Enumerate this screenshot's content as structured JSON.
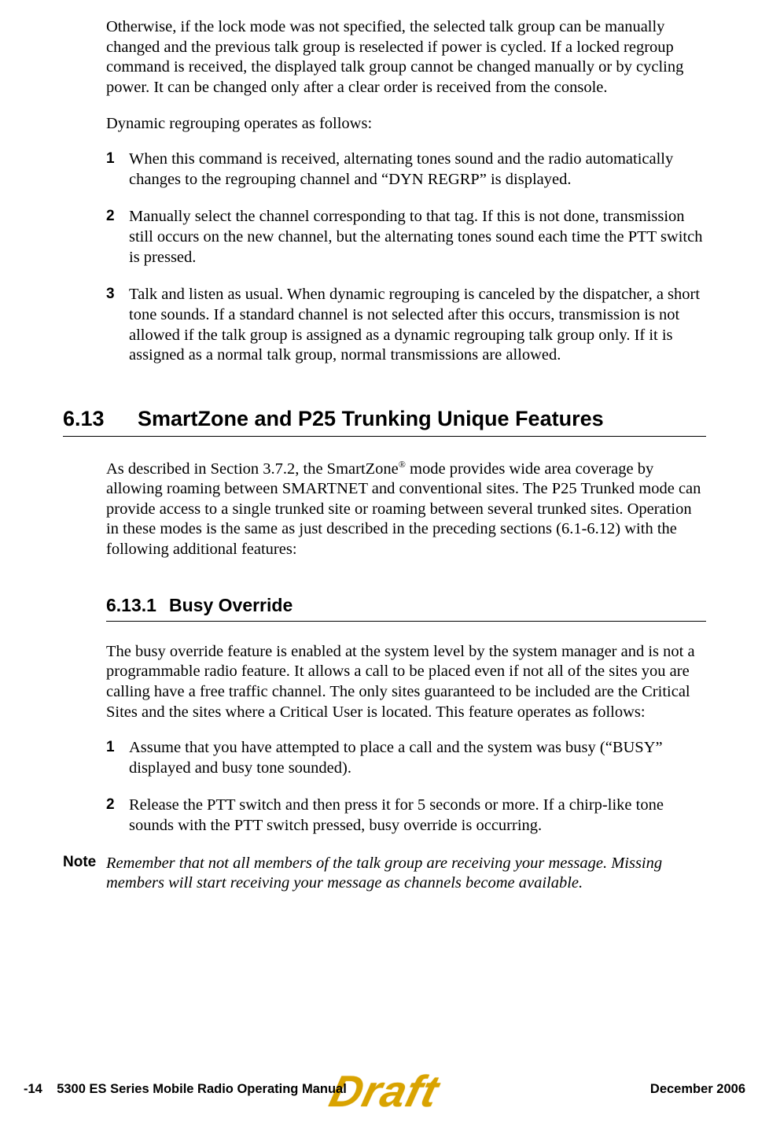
{
  "intro": {
    "para1": "Otherwise, if the lock mode was not specified, the selected talk group can be manually changed and the previous talk group is reselected if power is cycled. If a locked regroup command is received, the displayed talk group cannot be changed manually or by cycling power. It can be changed only after a clear order is received from the console.",
    "para2": "Dynamic regrouping operates as follows:"
  },
  "list1": {
    "items": [
      {
        "n": "1",
        "text": "When this command is received, alternating tones sound and the radio automatically changes to the regrouping channel and “DYN REGRP” is displayed."
      },
      {
        "n": "2",
        "text": "Manually select the channel corresponding to that tag. If this is not done, transmission still occurs on the new channel, but the alternating tones sound each time the PTT switch is pressed."
      },
      {
        "n": "3",
        "text": "Talk and listen as usual. When dynamic regrouping is canceled by the dispatcher, a short tone sounds. If a standard channel is not selected after this occurs, transmission is not allowed if the talk group is assigned as a dynamic regrouping talk group only. If it is assigned as a normal talk group, normal transmissions are allowed."
      }
    ]
  },
  "section613": {
    "num": "6.13",
    "title": "SmartZone and P25 Trunking Unique Features",
    "intro_pre": "As described in Section 3.7.2, the SmartZone",
    "reg": "®",
    "intro_post": " mode provides wide area coverage by allowing roaming between SMARTNET and conventional sites. The P25 Trunked mode can provide access to a single trunked site or roaming between several trunked sites. Operation in these modes is the same as just described in the preceding sections (6.1-6.12) with the following additional features:"
  },
  "section6131": {
    "num": "6.13.1",
    "title": "Busy Override",
    "para": "The busy override feature is enabled at the system level by the system manager and is not a programmable radio feature. It allows a call to be placed even if not all of the sites you are calling have a free traffic channel. The only sites guaranteed to be included are the Critical Sites and the sites where a Critical User is located. This feature operates as follows:"
  },
  "list2": {
    "items": [
      {
        "n": "1",
        "text": "Assume that you have attempted to place a call and the system was busy (“BUSY” displayed and busy tone sounded)."
      },
      {
        "n": "2",
        "text": "Release the PTT switch and then press it for 5 seconds or more. If a chirp-like tone sounds with the PTT switch pressed, busy override is occurring."
      }
    ]
  },
  "note": {
    "label": "Note",
    "text": "Remember that not all members of the talk group are receiving your message. Missing members will start receiving your message as channels become available."
  },
  "footer": {
    "page": "-14",
    "manual": "5300 ES Series Mobile Radio Operating Manual",
    "date": "December 2006"
  },
  "watermark": "Draft"
}
